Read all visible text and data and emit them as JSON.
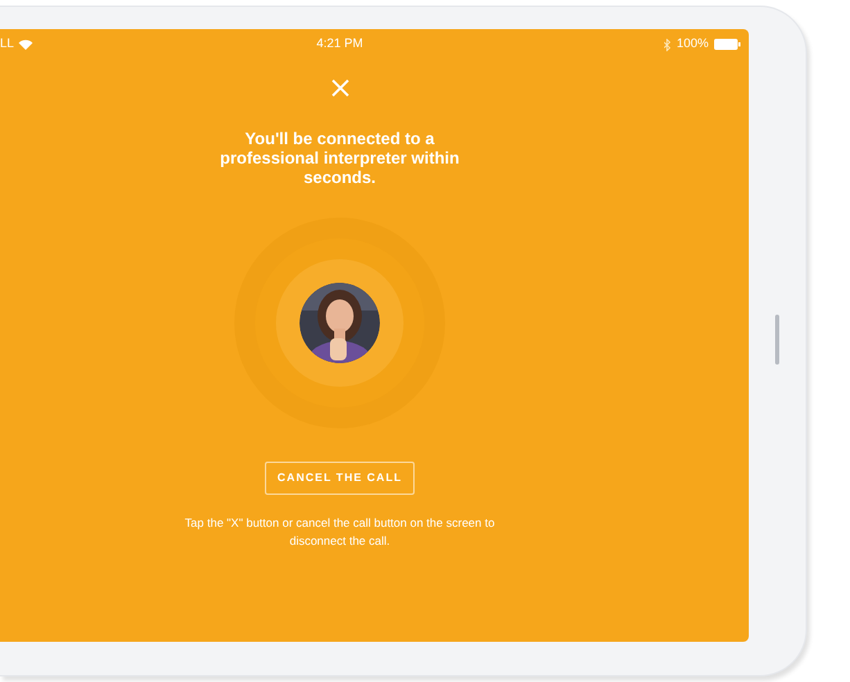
{
  "status_bar": {
    "carrier": "LL",
    "time": "4:21 PM",
    "battery": "100%"
  },
  "heading": "You'll  be connected to a professional interpreter within seconds.",
  "cancel_button": {
    "label": "CANCEL THE CALL"
  },
  "hint": "Tap the \"X\" button or cancel the call button on the screen to disconnect the call."
}
